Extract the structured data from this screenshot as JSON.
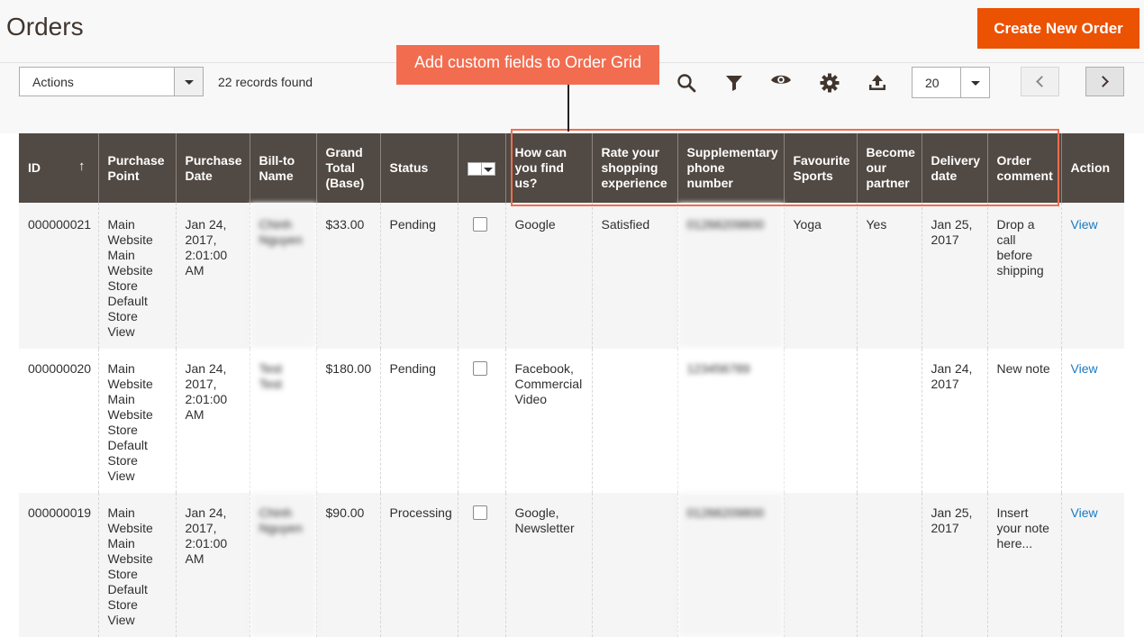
{
  "page": {
    "title": "Orders",
    "create_button": "Create New Order"
  },
  "toolbar": {
    "actions_label": "Actions",
    "records_found": "22 records found",
    "page_size": "20",
    "icons": [
      "search-icon",
      "filter-icon",
      "eye-icon",
      "gear-icon",
      "export-icon"
    ]
  },
  "callout": {
    "text": "Add custom fields to Order Grid"
  },
  "colors": {
    "accent": "#eb5202",
    "header_bg": "#514943",
    "callout": "#f26d50",
    "link": "#1979c3"
  },
  "grid": {
    "columns": [
      "ID",
      "Purchase Point",
      "Purchase Date",
      "Bill-to Name",
      "Grand Total (Base)",
      "Status",
      "",
      "How can you find us?",
      "Rate your shopping experience",
      "Supplementary phone number",
      "Favourite Sports",
      "Become our partner",
      "Delivery date",
      "Order comment",
      "Action"
    ],
    "sort_indicator": "↑",
    "rows": [
      {
        "id": "000000021",
        "purchase_point": "Main Website Main Website Store Default Store View",
        "purchase_date": "Jan 24, 2017, 2:01:00 AM",
        "bill_to": "Chinh Nguyen",
        "grand_total": "$33.00",
        "status": "Pending",
        "find_us": "Google",
        "rate": "Satisfied",
        "phone": "01266209800",
        "sports": "Yoga",
        "partner": "Yes",
        "delivery": "Jan 25, 2017",
        "comment": "Drop a call before shipping",
        "action": "View"
      },
      {
        "id": "000000020",
        "purchase_point": "Main Website Main Website Store Default Store View",
        "purchase_date": "Jan 24, 2017, 2:01:00 AM",
        "bill_to": "Test Test",
        "grand_total": "$180.00",
        "status": "Pending",
        "find_us": "Facebook, Commercial Video",
        "rate": "",
        "phone": "123456789",
        "sports": "",
        "partner": "",
        "delivery": "Jan 24, 2017",
        "comment": "New note",
        "action": "View"
      },
      {
        "id": "000000019",
        "purchase_point": "Main Website Main Website Store Default Store View",
        "purchase_date": "Jan 24, 2017, 2:01:00 AM",
        "bill_to": "Chinh Nguyen",
        "grand_total": "$90.00",
        "status": "Processing",
        "find_us": "Google, Newsletter",
        "rate": "",
        "phone": "01266209800",
        "sports": "",
        "partner": "",
        "delivery": "Jan 25, 2017",
        "comment": "Insert your note here...",
        "action": "View"
      }
    ]
  }
}
